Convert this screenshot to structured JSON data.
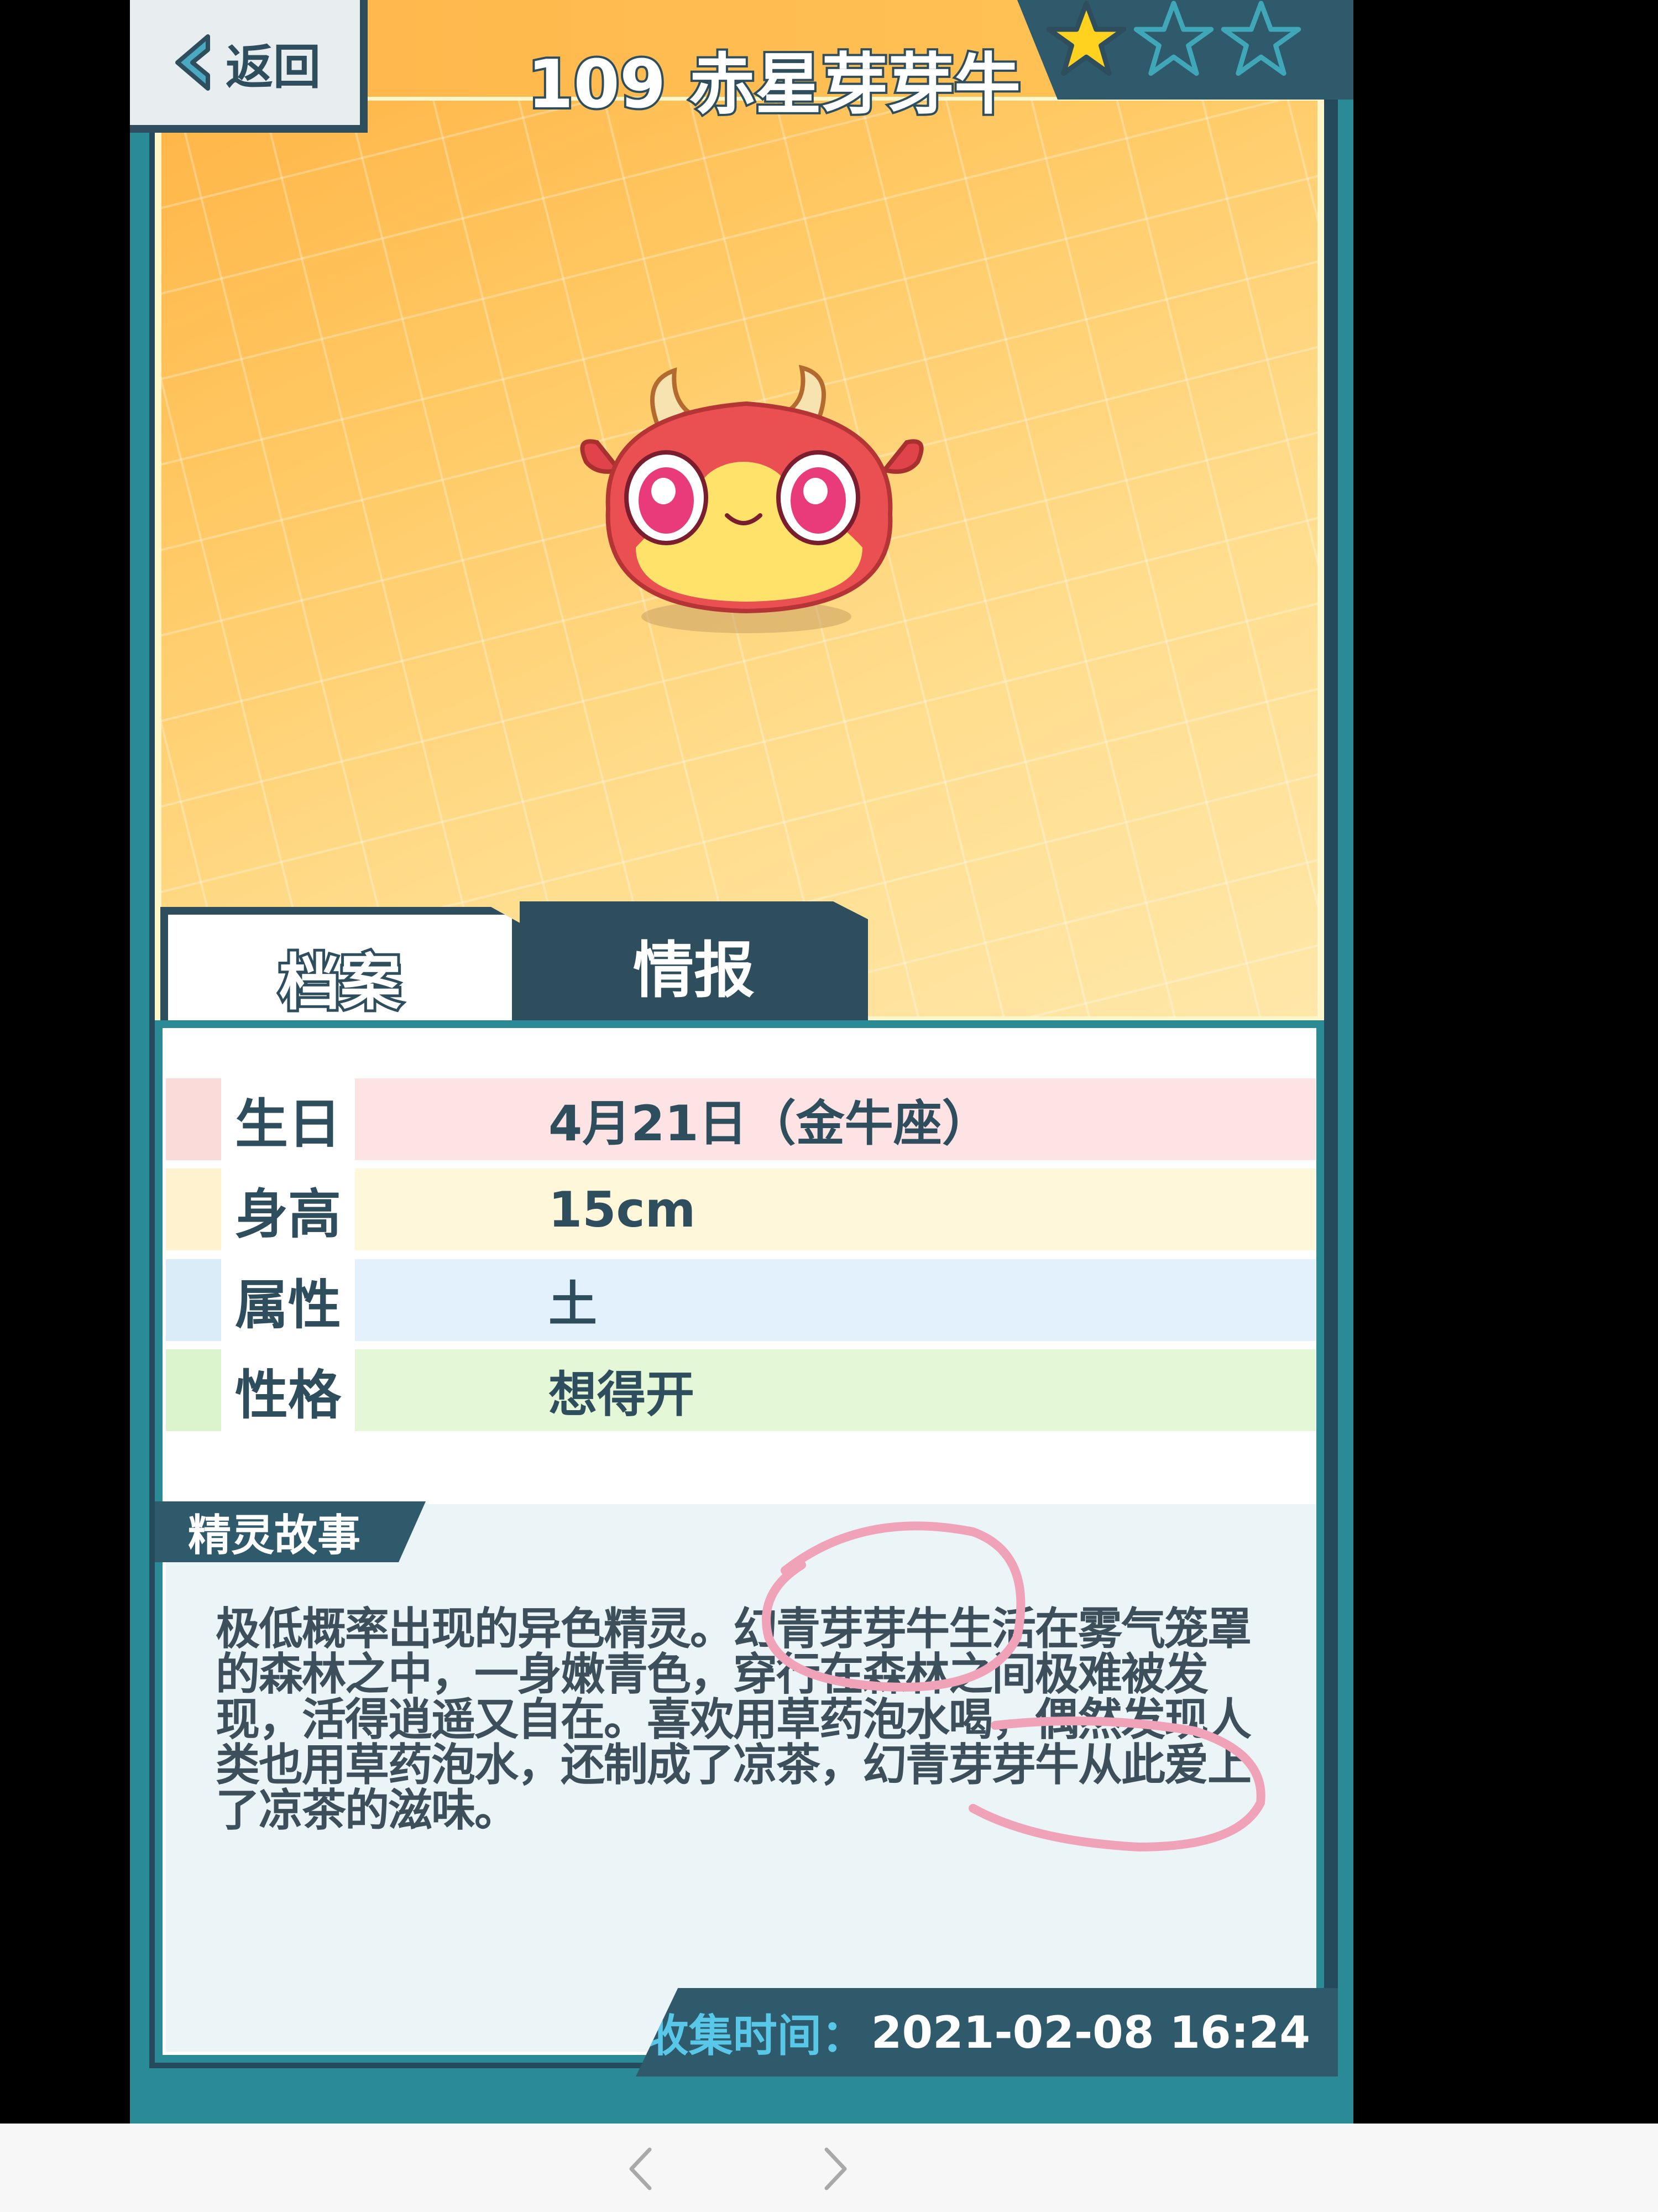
{
  "header": {
    "back_label": "返回",
    "title": "109 赤星芽芽牛",
    "stars_filled": 1,
    "stars_total": 3
  },
  "tabs": [
    {
      "label": "档案",
      "active": true
    },
    {
      "label": "情报",
      "active": false
    }
  ],
  "profile": {
    "rows": [
      {
        "key": "生日",
        "value": "4月21日（金牛座）",
        "color": "#fde3e3",
        "strip": "#fbdada"
      },
      {
        "key": "身高",
        "value": "15cm",
        "color": "#fff7d9",
        "strip": "#fff3cf"
      },
      {
        "key": "属性",
        "value": "土",
        "color": "#e2f1fb",
        "strip": "#d9ecf8"
      },
      {
        "key": "性格",
        "value": "想得开",
        "color": "#e4f8d8",
        "strip": "#dcf4cd"
      }
    ]
  },
  "story": {
    "heading": "精灵故事",
    "text": "极低概率出现的异色精灵。幻青芽芽牛生活在雾气笼罩的森林之中，一身嫩青色，穿行在森林之间极难被发现，活得逍遥又自在。喜欢用草药泡水喝，偶然发现人类也用草药泡水，还制成了凉茶，幻青芽芽牛从此爱上了凉茶的滋味。"
  },
  "collect": {
    "label": "收集时间：",
    "value": "2021-02-08 16:24"
  },
  "colors": {
    "frame": "#2a8a95",
    "dark": "#2e4d5d",
    "accent_yellow": "#ffc964",
    "annotation": "#f0a3b8"
  },
  "nav": {
    "back_icon": "chevron-left-icon",
    "forward_icon": "chevron-right-icon"
  }
}
